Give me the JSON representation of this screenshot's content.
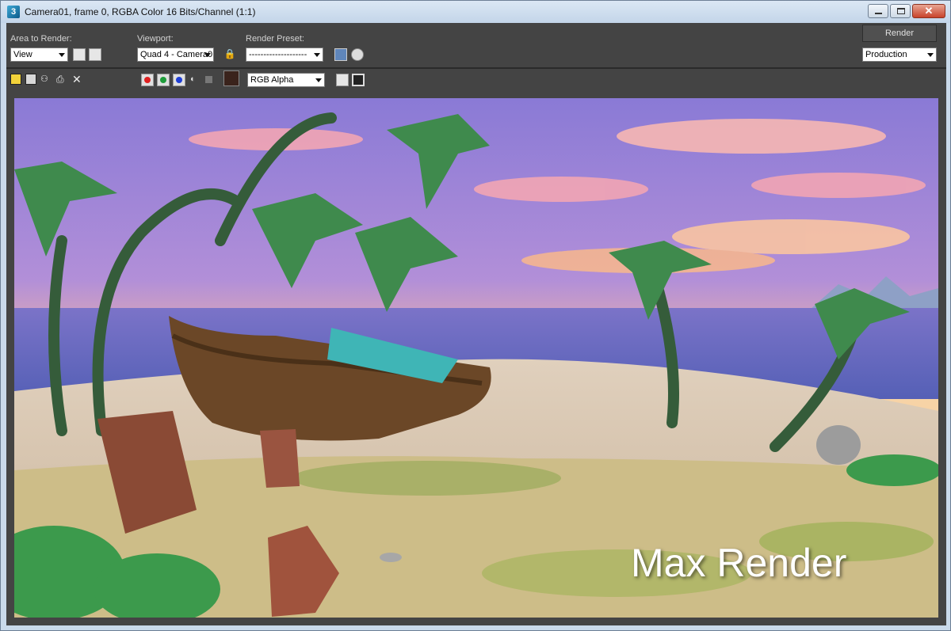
{
  "window": {
    "title": "Camera01, frame 0, RGBA Color 16 Bits/Channel (1:1)",
    "app_icon": "3ds-max-icon"
  },
  "toolbar": {
    "area_label": "Area to Render:",
    "area_value": "View",
    "viewport_label": "Viewport:",
    "viewport_value": "Quad 4 - Camera0",
    "preset_label": "Render Preset:",
    "preset_value": "--------------------",
    "render_button": "Render",
    "production_value": "Production",
    "channel_value": "RGB Alpha"
  },
  "colors": {
    "toolbar_bg": "#444444",
    "titlebar": "#c9d9ea",
    "swatch": "#3a231c",
    "red": "#e02020",
    "green": "#1f9d3b",
    "blue": "#1f3fd6"
  },
  "render": {
    "watermark": "Max Render"
  }
}
